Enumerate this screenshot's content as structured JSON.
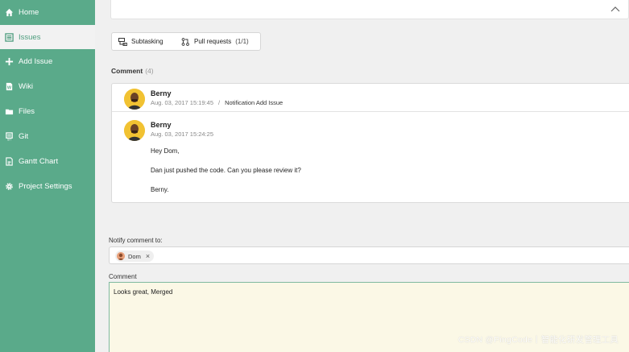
{
  "sidebar": {
    "items": [
      {
        "label": "Home",
        "icon": "home-icon"
      },
      {
        "label": "Issues",
        "icon": "issues-icon",
        "active": true
      },
      {
        "label": "Add Issue",
        "icon": "plus-icon"
      },
      {
        "label": "Wiki",
        "icon": "wiki-icon"
      },
      {
        "label": "Files",
        "icon": "folder-icon"
      },
      {
        "label": "Git",
        "icon": "git-icon"
      },
      {
        "label": "Gantt Chart",
        "icon": "gantt-chart-icon"
      },
      {
        "label": "Project Settings",
        "icon": "gear-icon"
      }
    ]
  },
  "tabs": {
    "subtasking": "Subtasking",
    "pull_requests": "Pull requests",
    "pull_requests_count": "(1/1)"
  },
  "comments": {
    "heading": "Comment",
    "count": "(4)",
    "items": [
      {
        "author": "Berny",
        "timestamp": "Aug. 03, 2017 15:19:45",
        "separator": "/",
        "action": "Notification Add Issue"
      },
      {
        "author": "Berny",
        "timestamp": "Aug. 03, 2017 15:24:25",
        "lines": [
          "Hey Dom,",
          "Dan just pushed the code. Can you please review it?",
          "Berny."
        ]
      }
    ]
  },
  "notify": {
    "label": "Notify comment to:",
    "recipient": "Dom",
    "remove_symbol": "×"
  },
  "comment_form": {
    "label": "Comment",
    "value": "Looks great, Merged"
  },
  "watermark": "CSDN @PingCode丨智能化研发管理工具",
  "colors": {
    "sidebar_bg": "#5aaa8a",
    "avatar_bg": "#f1c232",
    "textarea_bg": "#fbf8e6",
    "accent": "#4e9d7e"
  }
}
